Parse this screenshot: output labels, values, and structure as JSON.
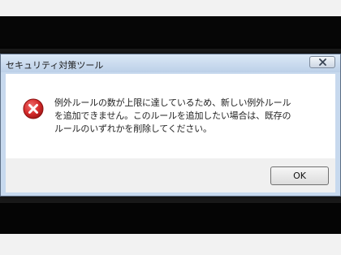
{
  "dialog": {
    "title": "セキュリティ対策ツール",
    "message": "例外ルールの数が上限に達しているため、新しい例外ルールを追加できません。このルールを追加したい場合は、既存のルールのいずれかを削除してください。",
    "ok_label": "OK",
    "icon": "error-icon",
    "close_icon": "close-icon"
  },
  "colors": {
    "frame": "#c7d9ee",
    "error_red": "#d42a2a",
    "content_bg": "#ffffff",
    "footer_bg": "#f0f0f0"
  }
}
